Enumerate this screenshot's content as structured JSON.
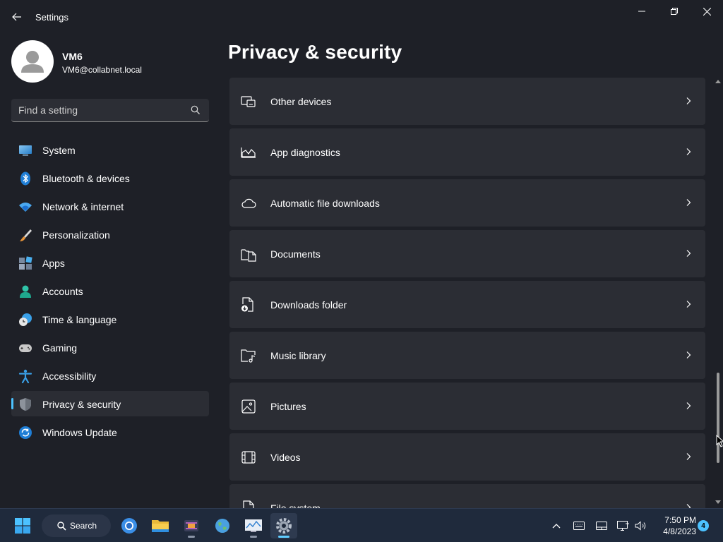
{
  "window": {
    "title": "Settings"
  },
  "profile": {
    "name": "VM6",
    "email": "VM6@collabnet.local"
  },
  "search": {
    "placeholder": "Find a setting"
  },
  "sidebar": {
    "items": [
      {
        "label": "System",
        "icon": "system-icon"
      },
      {
        "label": "Bluetooth & devices",
        "icon": "bluetooth-icon"
      },
      {
        "label": "Network & internet",
        "icon": "wifi-icon"
      },
      {
        "label": "Personalization",
        "icon": "brush-icon"
      },
      {
        "label": "Apps",
        "icon": "apps-icon"
      },
      {
        "label": "Accounts",
        "icon": "person-icon"
      },
      {
        "label": "Time & language",
        "icon": "clock-globe-icon"
      },
      {
        "label": "Gaming",
        "icon": "gamepad-icon"
      },
      {
        "label": "Accessibility",
        "icon": "accessibility-icon"
      },
      {
        "label": "Privacy & security",
        "icon": "shield-icon",
        "active": true
      },
      {
        "label": "Windows Update",
        "icon": "update-icon"
      }
    ]
  },
  "main": {
    "title": "Privacy & security",
    "rows": [
      {
        "label": "Other devices",
        "icon": "other-devices-icon"
      },
      {
        "label": "App diagnostics",
        "icon": "diagnostics-chart-icon"
      },
      {
        "label": "Automatic file downloads",
        "icon": "cloud-icon"
      },
      {
        "label": "Documents",
        "icon": "documents-icon"
      },
      {
        "label": "Downloads folder",
        "icon": "download-file-icon"
      },
      {
        "label": "Music library",
        "icon": "music-folder-icon"
      },
      {
        "label": "Pictures",
        "icon": "picture-icon"
      },
      {
        "label": "Videos",
        "icon": "video-film-icon"
      },
      {
        "label": "File system",
        "icon": "file-icon"
      }
    ]
  },
  "taskbar": {
    "search_label": "Search",
    "apps": [
      "chrome-icon",
      "file-explorer-icon",
      "video-editor-icon",
      "globe-app-icon",
      "monitor-app-icon",
      "settings-gear-icon"
    ],
    "clock_time": "7:50 PM",
    "clock_date": "4/8/2023",
    "notification_count": "4"
  },
  "colors": {
    "accent": "#4cc2ff",
    "background": "#1e2027",
    "card": "#2b2d34",
    "taskbar": "#1f2a3c"
  }
}
